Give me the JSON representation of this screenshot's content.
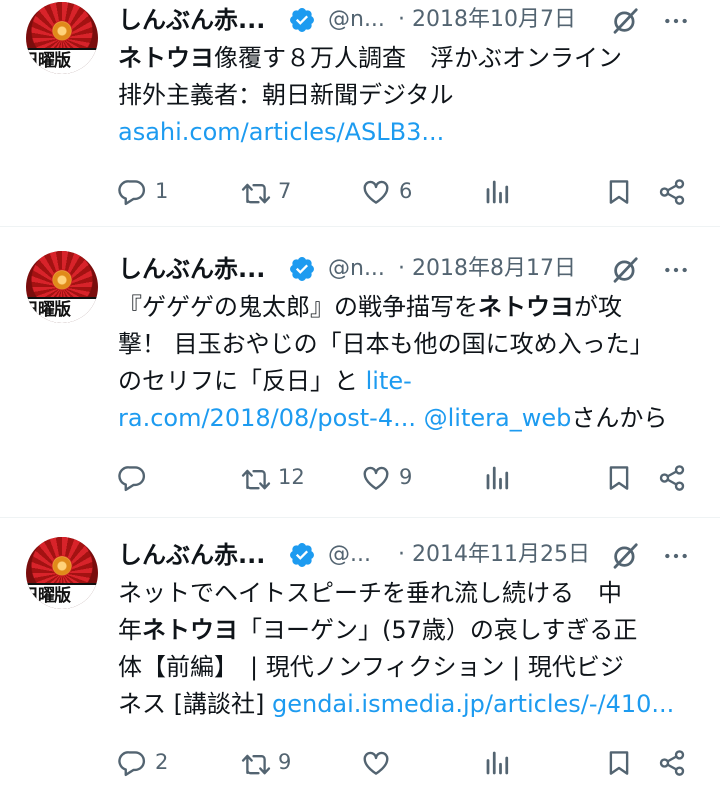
{
  "tweets": [
    {
      "name": "しんぶん赤...",
      "handle": "@n...",
      "separator": "·",
      "date": "2018年10月7日",
      "body": [
        [
          {
            "t": "ネトウヨ",
            "b": true
          },
          {
            "t": "像覆す８万人調査　浮かぶオンライン"
          }
        ],
        [
          {
            "t": "排外主義者：朝日新聞デジタル"
          }
        ],
        [
          {
            "t": "asahi.com/articles/ASLB3...",
            "link": true
          }
        ]
      ],
      "replies": "1",
      "retweets": "7",
      "likes": "6"
    },
    {
      "name": "しんぶん赤...",
      "handle": "@n...",
      "separator": "·",
      "date": "2018年8月17日",
      "body": [
        [
          {
            "t": "『ゲゲゲの鬼太郎』の戦争描写を"
          },
          {
            "t": "ネトウヨ",
            "b": true
          },
          {
            "t": "が攻"
          }
        ],
        [
          {
            "t": "撃！ 目玉おやじの「日本も他の国に攻め入った」"
          }
        ],
        [
          {
            "t": "のセリフに「反日」と "
          },
          {
            "t": "lite-",
            "link": true
          }
        ],
        [
          {
            "t": "ra.com/2018/08/post-4...",
            "link": true
          },
          {
            "t": " "
          },
          {
            "t": "@litera_web",
            "link": true
          },
          {
            "t": "さんから"
          }
        ]
      ],
      "replies": "",
      "retweets": "12",
      "likes": "9"
    },
    {
      "name": "しんぶん赤...",
      "handle": "@...",
      "separator": "·",
      "date": "2014年11月25日",
      "body": [
        [
          {
            "t": "ネットでヘイトスピーチを垂れ流し続ける　中"
          }
        ],
        [
          {
            "t": "年"
          },
          {
            "t": "ネトウヨ",
            "b": true
          },
          {
            "t": "「ヨーゲン」(57歳）の哀しすぎる正"
          }
        ],
        [
          {
            "t": "体【前編】　| 現代ノンフィクション | 現代ビジ"
          }
        ],
        [
          {
            "t": "ネス [講談社] "
          },
          {
            "t": "gendai.ismedia.jp/articles/-/410...",
            "link": true
          }
        ]
      ],
      "replies": "2",
      "retweets": "9",
      "likes": ""
    }
  ],
  "colors": {
    "link": "#1d9bf0",
    "muted": "#536471",
    "text": "#0f1419",
    "verified": "#1d9bf0"
  },
  "avatar_text": "日曜版",
  "icons": [
    "verified-badge-icon",
    "grok-icon",
    "more-icon",
    "reply-icon",
    "retweet-icon",
    "like-icon",
    "views-icon",
    "bookmark-icon",
    "share-icon"
  ]
}
